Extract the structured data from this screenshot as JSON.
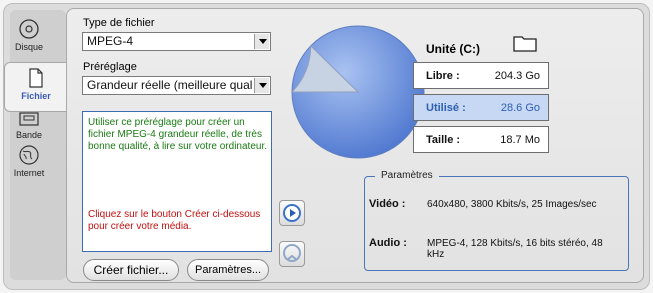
{
  "sidebar": {
    "items": [
      {
        "label": "Disque",
        "icon": "disc-icon"
      },
      {
        "label": "Fichier",
        "icon": "file-icon"
      },
      {
        "label": "Bande",
        "icon": "tape-icon"
      },
      {
        "label": "Internet",
        "icon": "globe-icon"
      }
    ],
    "active": "Fichier"
  },
  "form": {
    "file_type_label": "Type de fichier",
    "file_type_value": "MPEG-4",
    "preset_label": "Préréglage",
    "preset_value": "Grandeur réelle (meilleure qual"
  },
  "description": {
    "text": "Utiliser ce préréglage pour créer un fichier MPEG-4 grandeur réelle, de très bonne qualité, à lire sur votre ordinateur.",
    "hint": "Cliquez sur le bouton Créer ci-dessous pour créer votre média."
  },
  "buttons": {
    "create": "Créer fichier...",
    "params": "Paramètres..."
  },
  "drive": {
    "title": "Unité (C:)",
    "rows": [
      {
        "key": "Libre :",
        "value": "204.3 Go"
      },
      {
        "key": "Utilisé :",
        "value": "28.6 Go"
      },
      {
        "key": "Taille :",
        "value": "18.7 Mo"
      }
    ],
    "used_fraction": 0.123
  },
  "parameters": {
    "legend": "Paramètres",
    "video_key": "Vidéo :",
    "video_value": "640x480, 3800 Kbits/s, 25 Images/sec",
    "audio_key": "Audio :",
    "audio_value": "MPEG-4, 128 Kbits/s, 16 bits stéréo, 48 kHz"
  },
  "colors": {
    "accent": "#3a5bb5",
    "pie_free": "#6f95e0",
    "pie_used": "#c7d2e2"
  }
}
